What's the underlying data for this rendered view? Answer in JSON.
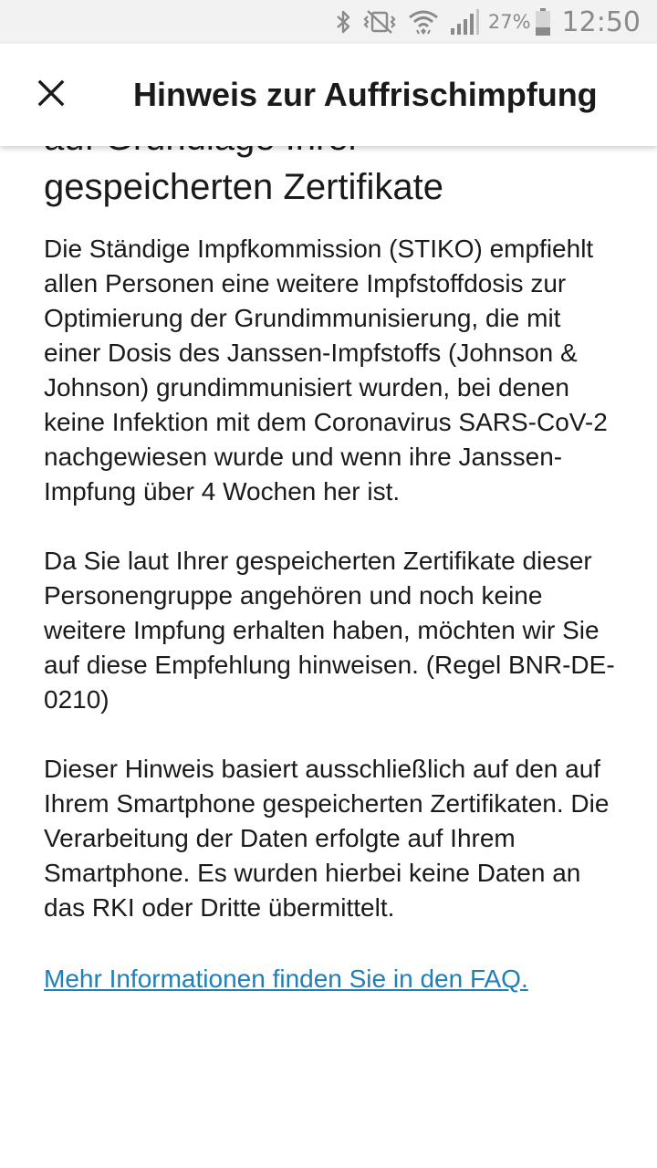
{
  "status_bar": {
    "battery_percent": "27%",
    "time": "12:50",
    "icons": [
      "bluetooth-icon",
      "vibrate-icon",
      "wifi-icon",
      "signal-icon",
      "battery-icon"
    ]
  },
  "app_bar": {
    "close_icon": "close-icon",
    "title": "Hinweis zur Auffrischimpfung"
  },
  "content": {
    "heading_line1": "auf Grundlage Ihrer",
    "heading_line2": "gespeicherten Zertifikate",
    "paragraphs": [
      "Die Ständige Impfkommission (STIKO) empfiehlt allen Personen eine weitere Impfstoffdosis zur Optimierung der Grundimmunisierung, die mit einer Dosis des Janssen-Impfstoffs (Johnson & Johnson) grundimmunisiert wurden, bei denen keine Infektion mit dem Coronavirus SARS-CoV-2 nachgewiesen wurde und wenn ihre Janssen-Impfung über 4 Wochen her ist.",
      "Da Sie laut Ihrer gespeicherten Zertifikate dieser Personengruppe angehören und noch keine weitere Impfung erhalten haben, möchten wir Sie auf diese Empfehlung hinweisen. (Regel BNR-DE-0210)",
      "Dieser Hinweis basiert ausschließlich auf den auf Ihrem Smartphone gespeicherten Zertifikaten. Die Verarbeitung der Daten erfolgte auf Ihrem Smartphone. Es wurden hierbei keine Daten an das RKI oder Dritte übermittelt."
    ],
    "faq_link": "Mehr Informationen finden Sie in den FAQ."
  },
  "colors": {
    "link": "#1f7fb8",
    "status_bar_bg": "#f2f2f2",
    "text": "#1a1a1a"
  }
}
